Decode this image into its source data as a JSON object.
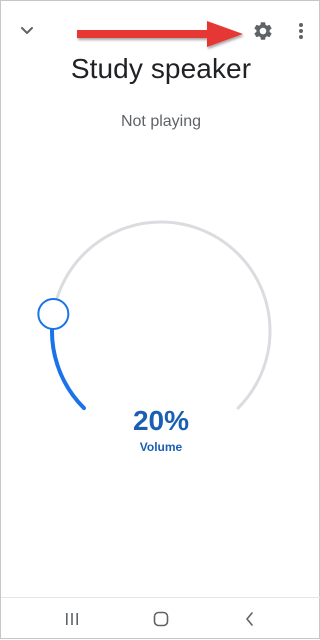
{
  "header": {
    "collapse_icon": "chevron-down-icon",
    "settings_icon": "gear-icon",
    "more_icon": "more-vert-icon"
  },
  "device": {
    "name": "Study speaker",
    "status": "Not playing"
  },
  "volume": {
    "display": "20%",
    "label": "Volume",
    "level": 0.2
  },
  "annotation": {
    "type": "arrow",
    "color": "#e53935",
    "points_to": "settings"
  },
  "navbar": {
    "recents_icon": "recents-icon",
    "home_icon": "home-icon",
    "back_icon": "back-icon"
  },
  "colors": {
    "accent": "#1a73e8",
    "accent_text": "#1a5fb4",
    "track": "#dadce0",
    "title": "#202124",
    "subtitle": "#5f6368"
  }
}
